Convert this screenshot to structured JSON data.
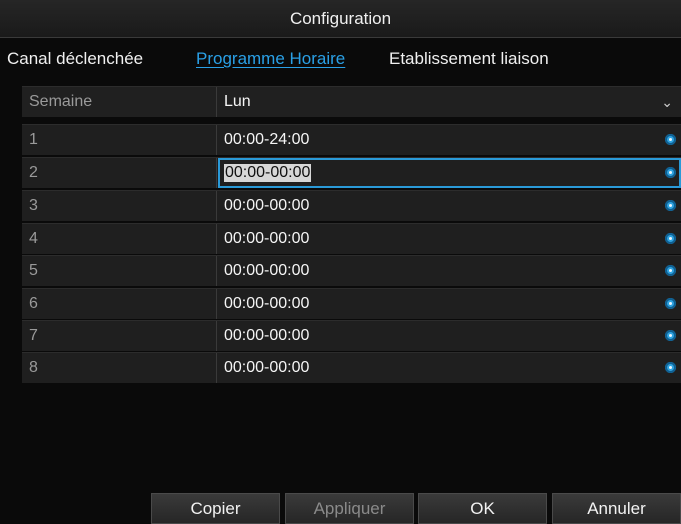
{
  "window": {
    "title": "Configuration"
  },
  "tabs": [
    {
      "label": "Canal déclenchée"
    },
    {
      "label": "Programme Horaire"
    },
    {
      "label": "Etablissement liaison"
    }
  ],
  "schedule": {
    "week_label": "Semaine",
    "week_value": "Lun",
    "rows": [
      {
        "index": "1",
        "time": "00:00-24:00"
      },
      {
        "index": "2",
        "time": "00:00-00:00"
      },
      {
        "index": "3",
        "time": "00:00-00:00"
      },
      {
        "index": "4",
        "time": "00:00-00:00"
      },
      {
        "index": "5",
        "time": "00:00-00:00"
      },
      {
        "index": "6",
        "time": "00:00-00:00"
      },
      {
        "index": "7",
        "time": "00:00-00:00"
      },
      {
        "index": "8",
        "time": "00:00-00:00"
      }
    ]
  },
  "footer": {
    "copy": "Copier",
    "apply": "Appliquer",
    "ok": "OK",
    "cancel": "Annuler"
  },
  "colors": {
    "accent": "#2aa0e6",
    "background": "#0a0a0a",
    "row": "#1f1f1f"
  },
  "icons": {
    "time_picker": "clock-icon",
    "dropdown": "chevron-down-icon"
  }
}
